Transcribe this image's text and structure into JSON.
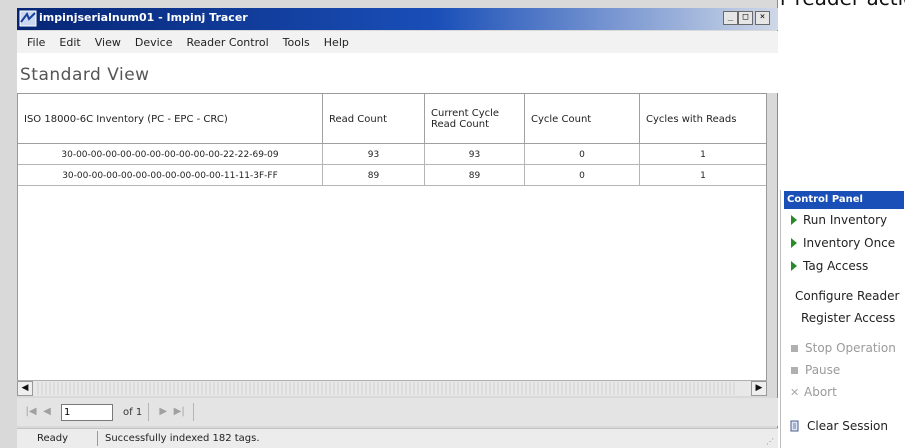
{
  "window": {
    "title": "impinjserialnum01 - Impinj Tracer",
    "min_label": "_",
    "max_label": "□",
    "close_label": "×"
  },
  "menu": [
    "File",
    "Edit",
    "View",
    "Device",
    "Reader Control",
    "Tools",
    "Help"
  ],
  "view_title": "Standard View",
  "grid": {
    "columns": [
      "ISO 18000-6C Inventory (PC - EPC - CRC)",
      "Read Count",
      "Current Cycle Read Count",
      "Cycle Count",
      "Cycles with Reads"
    ],
    "rows": [
      [
        "30-00-00-00-00-00-00-00-00-00-00-22-22-69-09",
        "93",
        "93",
        "0",
        "1"
      ],
      [
        "30-00-00-00-00-00-00-00-00-00-00-11-11-3F-FF",
        "89",
        "89",
        "0",
        "1"
      ]
    ]
  },
  "pager": {
    "page": "1",
    "of_label": "of 1"
  },
  "status": {
    "ready": "Ready",
    "message": "Successfully indexed 182 tags."
  },
  "control_panel": {
    "title": "Control Panel",
    "items": [
      "Run Inventory",
      "Inventory Once",
      "Tag Access",
      "Configure Reader",
      "Register Access",
      "Stop Operation",
      "Pause",
      "Abort",
      "Clear Session"
    ]
  },
  "top_crop_text": "r reader actions."
}
